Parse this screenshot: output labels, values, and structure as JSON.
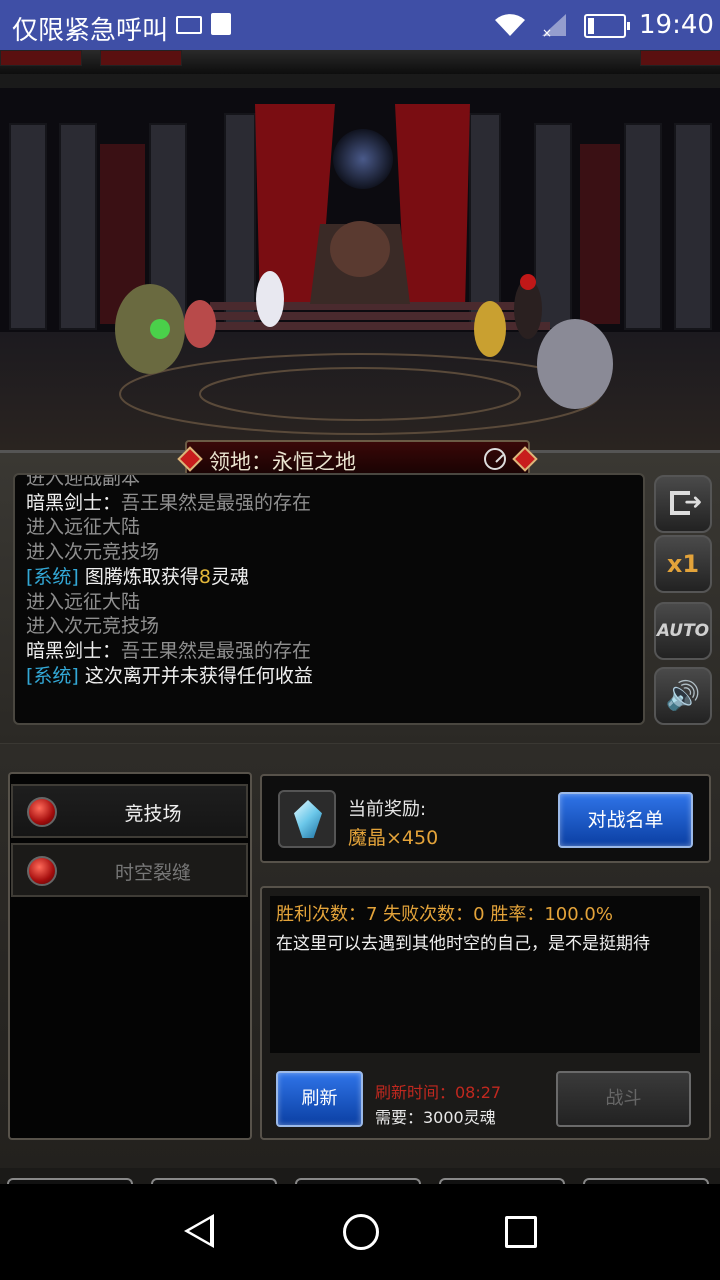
{
  "status_bar": {
    "carrier": "仅限紧急呼叫",
    "time": "19:40",
    "battery_level": 0.15,
    "icons": [
      "keyboard-icon",
      "sim-icon",
      "wifi-icon",
      "signal-icon",
      "battery-icon"
    ]
  },
  "location_banner": {
    "title": "领地：永恒之地",
    "timer_icon": "timer-icon"
  },
  "battle_log": [
    {
      "segments": [
        {
          "text": "进入迎战副本",
          "style": "dim"
        }
      ]
    },
    {
      "segments": [
        {
          "text": "暗黑剑士：",
          "style": "white"
        },
        {
          "text": "吾王果然是最强的存在",
          "style": "dim"
        }
      ]
    },
    {
      "segments": [
        {
          "text": "进入远征大陆",
          "style": "dim"
        }
      ]
    },
    {
      "segments": [
        {
          "text": "进入次元竞技场",
          "style": "dim"
        }
      ]
    },
    {
      "segments": [
        {
          "text": "[系统]",
          "style": "sys"
        },
        {
          "text": " 图腾炼取获得",
          "style": "white"
        },
        {
          "text": "8",
          "style": "gold"
        },
        {
          "text": "灵魂",
          "style": "white"
        }
      ]
    },
    {
      "segments": [
        {
          "text": "进入远征大陆",
          "style": "dim"
        }
      ]
    },
    {
      "segments": [
        {
          "text": "进入次元竞技场",
          "style": "dim"
        }
      ]
    },
    {
      "segments": [
        {
          "text": "暗黑剑士：",
          "style": "white"
        },
        {
          "text": "吾王果然是最强的存在",
          "style": "dim"
        }
      ]
    },
    {
      "segments": [
        {
          "text": "[系统]",
          "style": "sys"
        },
        {
          "text": " 这次离开并未获得任何收益",
          "style": "white"
        }
      ]
    }
  ],
  "side_controls": {
    "exit_icon": "exit-icon",
    "speed_label": "x1",
    "auto_label": "AUTO",
    "sound_icon": "speaker-icon"
  },
  "mode_tabs": [
    {
      "label": "竞技场",
      "active": true
    },
    {
      "label": "时空裂缝",
      "active": false
    }
  ],
  "reward": {
    "label": "当前奖励:",
    "value": "魔晶×450",
    "button": "对战名单",
    "icon": "crystal-icon"
  },
  "stats": {
    "summary": "胜利次数：7  失败次数：0  胜率：100.0%",
    "description": "在这里可以去遇到其他时空的自己，是不是挺期待"
  },
  "actions": {
    "refresh_button": "刷新",
    "refresh_time": "刷新时间：08:27",
    "requirement": "需要：3000灵魂",
    "fight_button": "战斗"
  },
  "colors": {
    "status_bar": "#3f4fa6",
    "gold_text": "#e3a33a",
    "system_tag": "#33a8d6",
    "refresh_time": "#c0281f",
    "blue_button": "#2f74e8"
  }
}
